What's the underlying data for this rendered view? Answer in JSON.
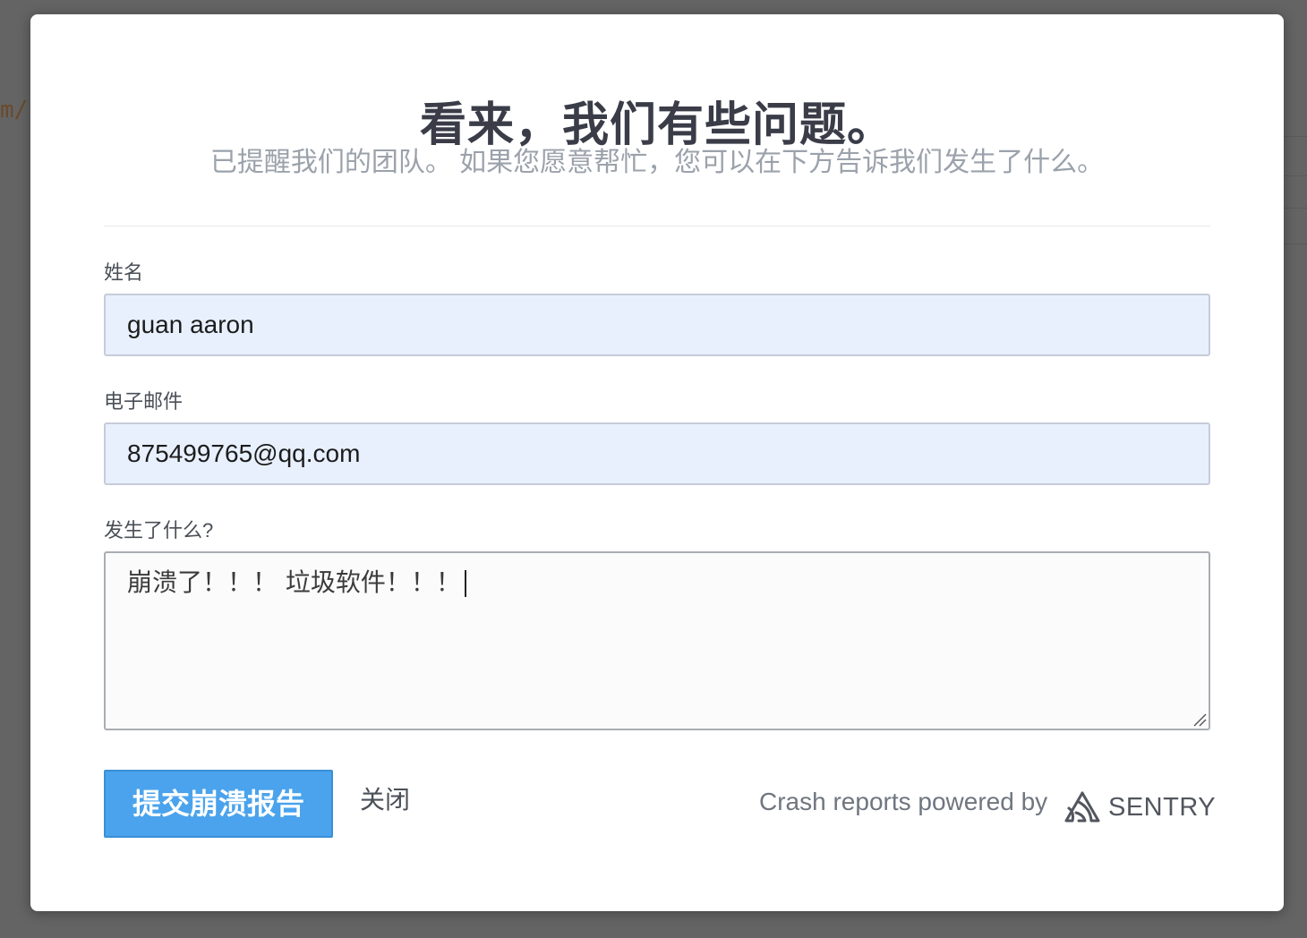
{
  "background": {
    "code_fragment": "m/"
  },
  "dialog": {
    "title": "看来，我们有些问题。",
    "subtitle": "已提醒我们的团队。 如果您愿意帮忙，您可以在下方告诉我们发生了什么。",
    "name_field": {
      "label": "姓名",
      "value": "guan aaron"
    },
    "email_field": {
      "label": "电子邮件",
      "value": "875499765@qq.com"
    },
    "comments_field": {
      "label": "发生了什么?",
      "value": "崩溃了！！！ 垃圾软件！！！"
    },
    "submit_label": "提交崩溃报告",
    "close_label": "关闭",
    "powered_by": "Crash reports powered by",
    "brand_name": "SENTRY",
    "brand_icon": "sentry-logo-icon"
  },
  "colors": {
    "primary_button": "#4aa3ec",
    "input_autofill": "#e8f0fe",
    "heading": "#3a3d48",
    "subheading": "#9ba2ab"
  }
}
